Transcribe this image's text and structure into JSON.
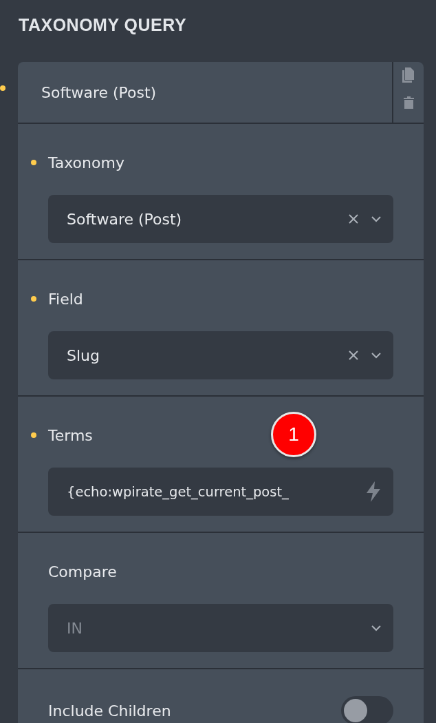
{
  "title": "TAXONOMY QUERY",
  "query": {
    "title": "Software (Post)",
    "modified": true
  },
  "controls": [
    {
      "kind": "select",
      "label": "Taxonomy",
      "modified": true,
      "value": "Software (Post)",
      "clearable": true,
      "disabled": false
    },
    {
      "kind": "select",
      "label": "Field",
      "modified": true,
      "value": "Slug",
      "clearable": true,
      "disabled": false
    },
    {
      "kind": "input",
      "label": "Terms",
      "modified": true,
      "value": "{echo:wpirate_get_current_post_",
      "badge": "1"
    },
    {
      "kind": "select",
      "label": "Compare",
      "modified": false,
      "value": "IN",
      "clearable": false,
      "disabled": true
    },
    {
      "kind": "toggle",
      "label": "Include Children",
      "modified": false,
      "on": false
    }
  ]
}
